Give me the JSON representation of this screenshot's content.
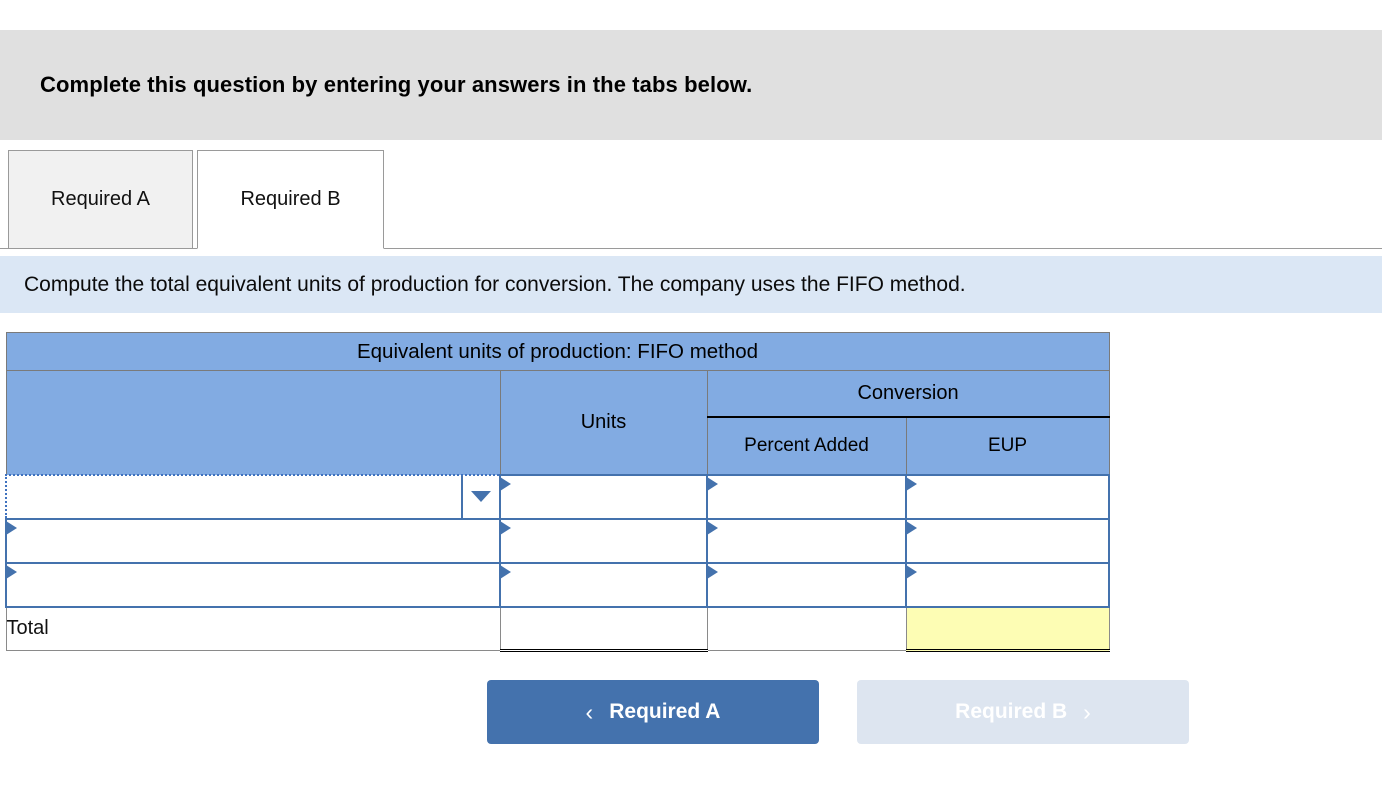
{
  "header": {
    "instruction": "Complete this question by entering your answers in the tabs below."
  },
  "tabs": [
    {
      "label": "Required A",
      "active": false
    },
    {
      "label": "Required B",
      "active": true
    }
  ],
  "requirement": {
    "text": "Compute the total equivalent units of production for conversion. The company uses the FIFO method."
  },
  "worksheet": {
    "title": "Equivalent units of production: FIFO method",
    "columns": {
      "description": "",
      "units": "Units",
      "group": "Conversion",
      "percent_added": "Percent Added",
      "eup": "EUP"
    },
    "rows": [
      {
        "description": "",
        "units": "",
        "percent_added": "",
        "eup": "",
        "has_dropdown": true,
        "focused": true
      },
      {
        "description": "",
        "units": "",
        "percent_added": "",
        "eup": "",
        "has_dropdown": false,
        "focused": false
      },
      {
        "description": "",
        "units": "",
        "percent_added": "",
        "eup": "",
        "has_dropdown": false,
        "focused": false
      }
    ],
    "total": {
      "label": "Total",
      "units": "",
      "percent_added": "",
      "eup": ""
    }
  },
  "navigation": {
    "prev_label": "Required A",
    "prev_icon": "chevron-left",
    "next_label": "Required B",
    "next_icon": "chevron-right"
  },
  "colors": {
    "band_gray": "#e0e0e0",
    "req_blue": "#dbe7f5",
    "header_blue": "#82abe2",
    "cell_border_blue": "#4472ad",
    "answer_yellow": "#fdfdb4",
    "btn_active": "#4472ad",
    "btn_disabled": "#dde5f0"
  }
}
